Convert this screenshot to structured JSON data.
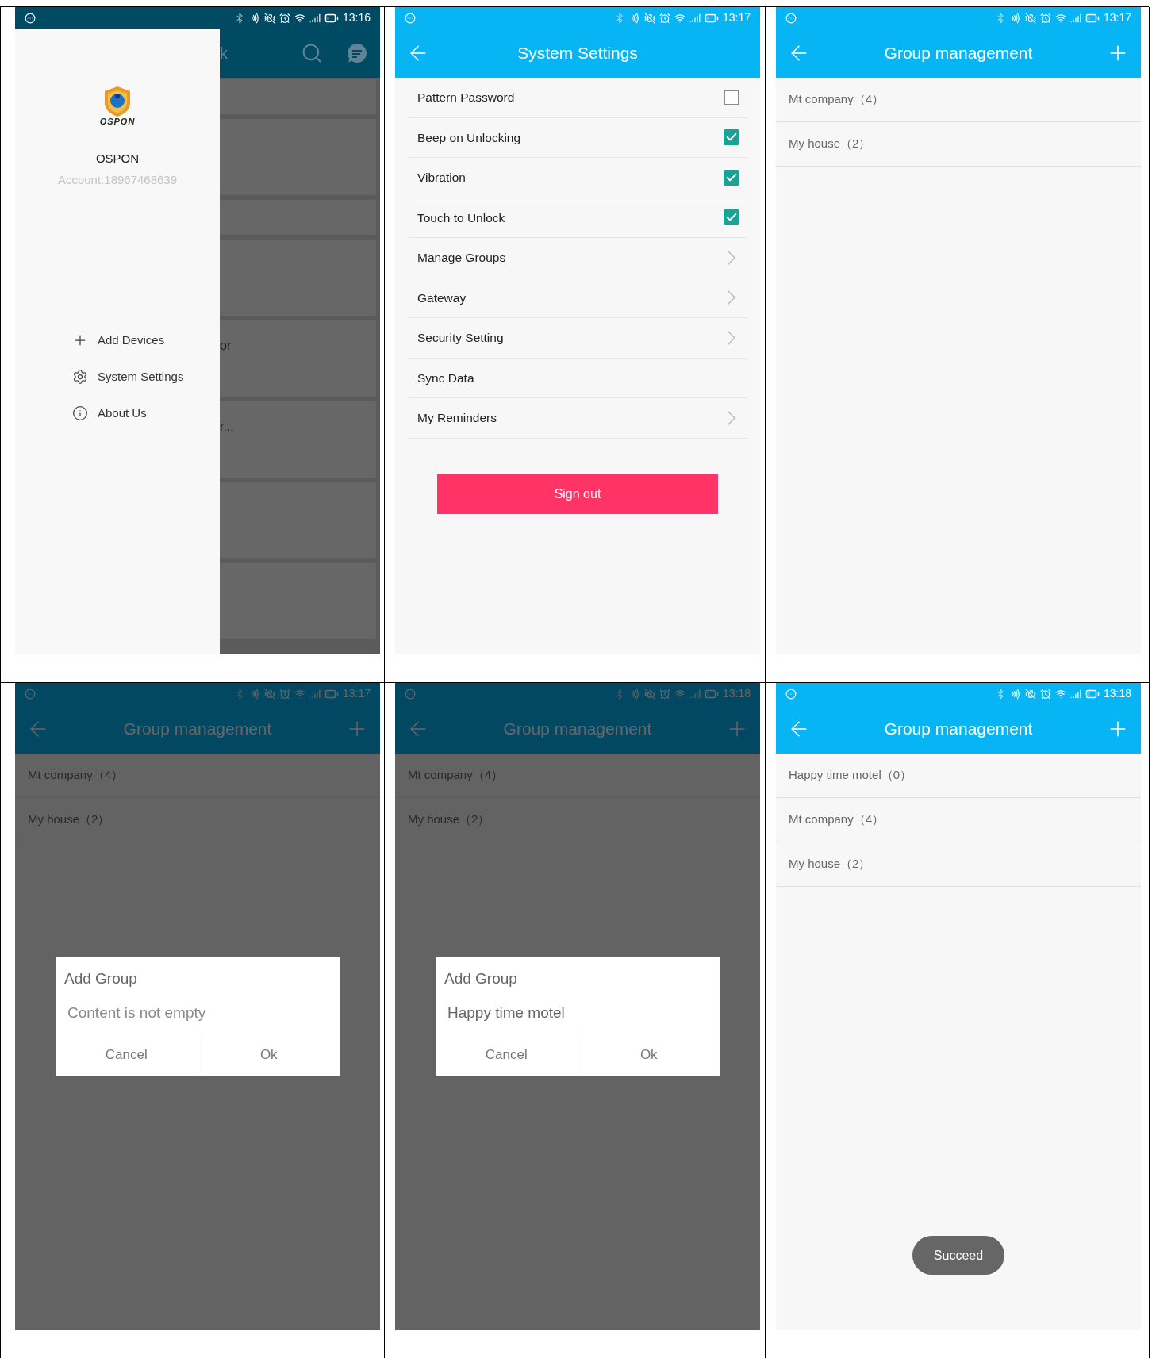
{
  "panels": [
    {
      "kind": "drawer",
      "time": "13:16",
      "brand_mark": "OSPON",
      "brand": "OSPON",
      "account": "Account:18967468639",
      "menu": [
        "Add Devices",
        "System Settings",
        "About Us"
      ],
      "background": {
        "title_fragment": "k",
        "cards": [
          {
            "kind": "short"
          },
          {
            "kind": "tall"
          },
          {
            "kind": "short"
          },
          {
            "kind": "tall"
          },
          {
            "kind": "tall",
            "text": "or"
          },
          {
            "kind": "tall",
            "text": "r..."
          },
          {
            "kind": "tall"
          },
          {
            "kind": "tall"
          }
        ]
      }
    },
    {
      "kind": "settings",
      "time": "13:17",
      "title": "System Settings",
      "rows": [
        {
          "kind": "checkbox",
          "label": "Pattern Password",
          "checked": false
        },
        {
          "kind": "checkbox",
          "label": "Beep on Unlocking",
          "checked": true
        },
        {
          "kind": "checkbox",
          "label": "Vibration",
          "checked": true
        },
        {
          "kind": "checkbox",
          "label": "Touch to Unlock",
          "checked": true
        },
        {
          "kind": "link",
          "label": "Manage Groups"
        },
        {
          "kind": "link",
          "label": "Gateway"
        },
        {
          "kind": "link",
          "label": "Security Setting"
        },
        {
          "kind": "plain",
          "label": "Sync Data"
        },
        {
          "kind": "link",
          "label": "My Reminders"
        }
      ],
      "sign_out": "Sign out"
    },
    {
      "kind": "groups",
      "time": "13:17",
      "title": "Group management",
      "dimmed": false,
      "groups": [
        "Mt company（4）",
        "My house（2）"
      ]
    },
    {
      "kind": "groups",
      "time": "13:17",
      "title": "Group management",
      "dimmed": true,
      "groups": [
        "Mt company（4）",
        "My house（2）"
      ],
      "dialog": {
        "title": "Add Group",
        "placeholder": "Content is not empty",
        "cancel": "Cancel",
        "ok": "Ok"
      }
    },
    {
      "kind": "groups",
      "time": "13:18",
      "title": "Group management",
      "dimmed": true,
      "groups": [
        "Mt company（4）",
        "My house（2）"
      ],
      "dialog": {
        "title": "Add Group",
        "value": "Happy time motel",
        "cancel": "Cancel",
        "ok": "Ok"
      }
    },
    {
      "kind": "groups",
      "time": "13:18",
      "title": "Group management",
      "dimmed": false,
      "groups": [
        "Happy time motel（0）",
        "Mt company（4）",
        "My house（2）"
      ],
      "toast": "Succeed"
    }
  ]
}
